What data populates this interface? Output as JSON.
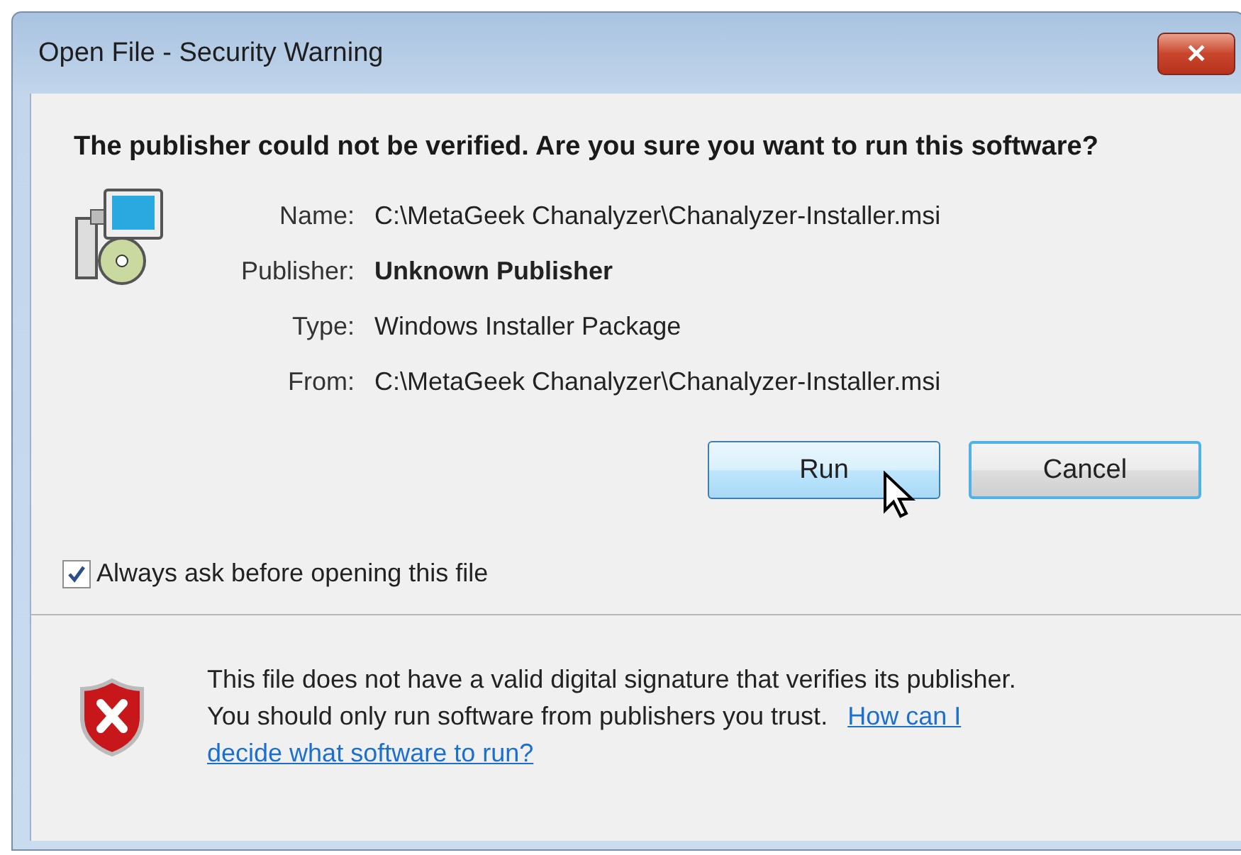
{
  "window": {
    "title": "Open File - Security Warning",
    "close": "✕"
  },
  "heading": "The publisher could not be verified.  Are you sure you want to run this software?",
  "details": [
    {
      "label": "Name:",
      "value": "C:\\MetaGeek Chanalyzer\\Chanalyzer-Installer.msi",
      "bold": false
    },
    {
      "label": "Publisher:",
      "value": "Unknown Publisher",
      "bold": true
    },
    {
      "label": "Type:",
      "value": "Windows Installer Package",
      "bold": false
    },
    {
      "label": "From:",
      "value": "C:\\MetaGeek Chanalyzer\\Chanalyzer-Installer.msi",
      "bold": false
    }
  ],
  "buttons": [
    {
      "label": "Run",
      "hovered": true
    },
    {
      "label": "Cancel",
      "hovered": false
    }
  ],
  "always_ask": {
    "label": "Always ask before opening this file",
    "checked": true
  },
  "footer": {
    "message_lines": [
      "This file does not have a valid digital signature that verifies its publisher.",
      "You should only run software from publishers you trust."
    ],
    "link_lines": [
      "How can I",
      "decide what software to run?"
    ]
  }
}
